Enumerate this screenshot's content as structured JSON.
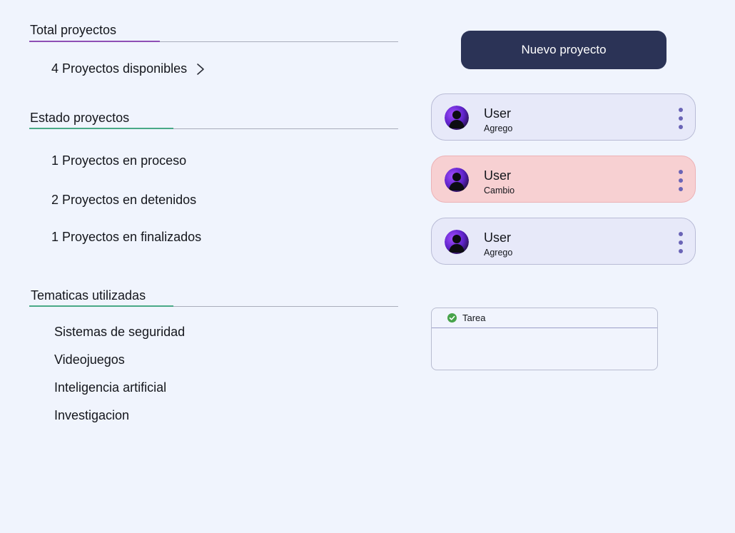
{
  "total_section": {
    "title": "Total proyectos",
    "link_label": "4 Proyectos disponibles",
    "accent_color": "#8e4fb5"
  },
  "status_section": {
    "title": "Estado proyectos",
    "accent_color": "#49a987",
    "items": [
      "1 Proyectos en proceso",
      "2 Proyectos en detenidos",
      "1 Proyectos en finalizados"
    ]
  },
  "topics_section": {
    "title": "Tematicas utilizadas",
    "accent_color": "#49a987",
    "items": [
      "Sistemas de seguridad",
      "Videojuegos",
      "Inteligencia artificial",
      "Investigacion"
    ]
  },
  "new_project_button": {
    "label": "Nuevo proyecto",
    "color": "#2b3356"
  },
  "activity": [
    {
      "user": "User",
      "action": "Agrego",
      "color": "#e7e9f9",
      "avatar_icon": "user-avatar-icon",
      "menu_icon": "kebab-menu-icon"
    },
    {
      "user": "User",
      "action": "Cambio",
      "color": "#f7d0d2",
      "avatar_icon": "user-avatar-icon",
      "menu_icon": "kebab-menu-icon"
    },
    {
      "user": "User",
      "action": "Agrego",
      "color": "#e7e9f9",
      "avatar_icon": "user-avatar-icon",
      "menu_icon": "kebab-menu-icon"
    }
  ],
  "task_panel": {
    "label": "Tarea",
    "status_icon": "check-circle-icon",
    "status_color": "#47a34a"
  }
}
